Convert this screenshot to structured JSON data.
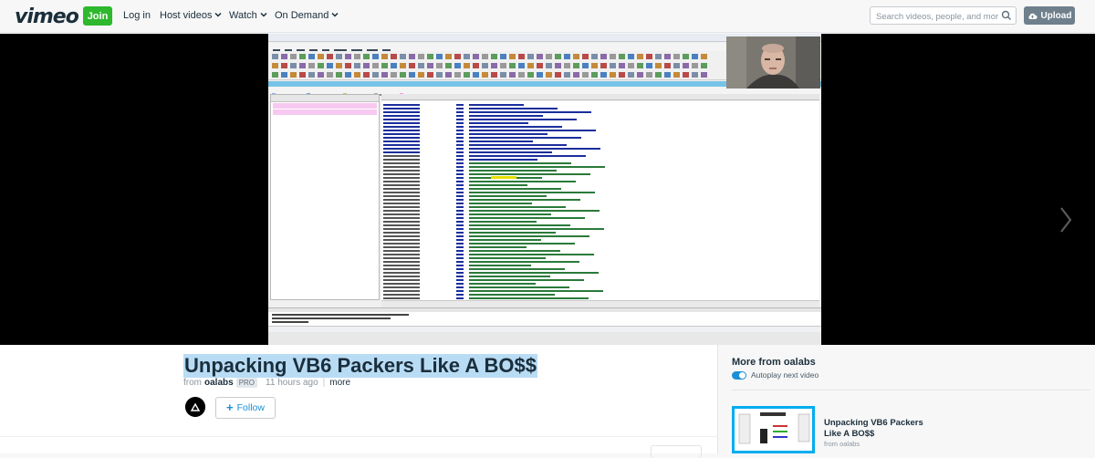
{
  "nav": {
    "logo": "vimeo",
    "join_label": "Join",
    "login_label": "Log in",
    "host_videos_label": "Host videos",
    "watch_label": "Watch",
    "on_demand_label": "On Demand",
    "search_placeholder": "Search videos, people, and more",
    "upload_label": "Upload"
  },
  "video": {
    "title": "Unpacking VB6 Packers Like A BO$$",
    "from_label": "from",
    "author": "oalabs",
    "badge": "PRO",
    "posted": "11 hours ago",
    "more_label": "more",
    "follow_label": "Follow"
  },
  "sidebar": {
    "heading": "More from oalabs",
    "autoplay_label": "Autoplay next video",
    "related": [
      {
        "title": "Unpacking VB6 Packers Like A BO$$",
        "author": "from oalabs"
      }
    ]
  },
  "colors": {
    "join": "#2eb82e",
    "accent": "#1a8fd6",
    "title_highlight": "#b9dcf5",
    "thumb_border": "#00adef"
  }
}
